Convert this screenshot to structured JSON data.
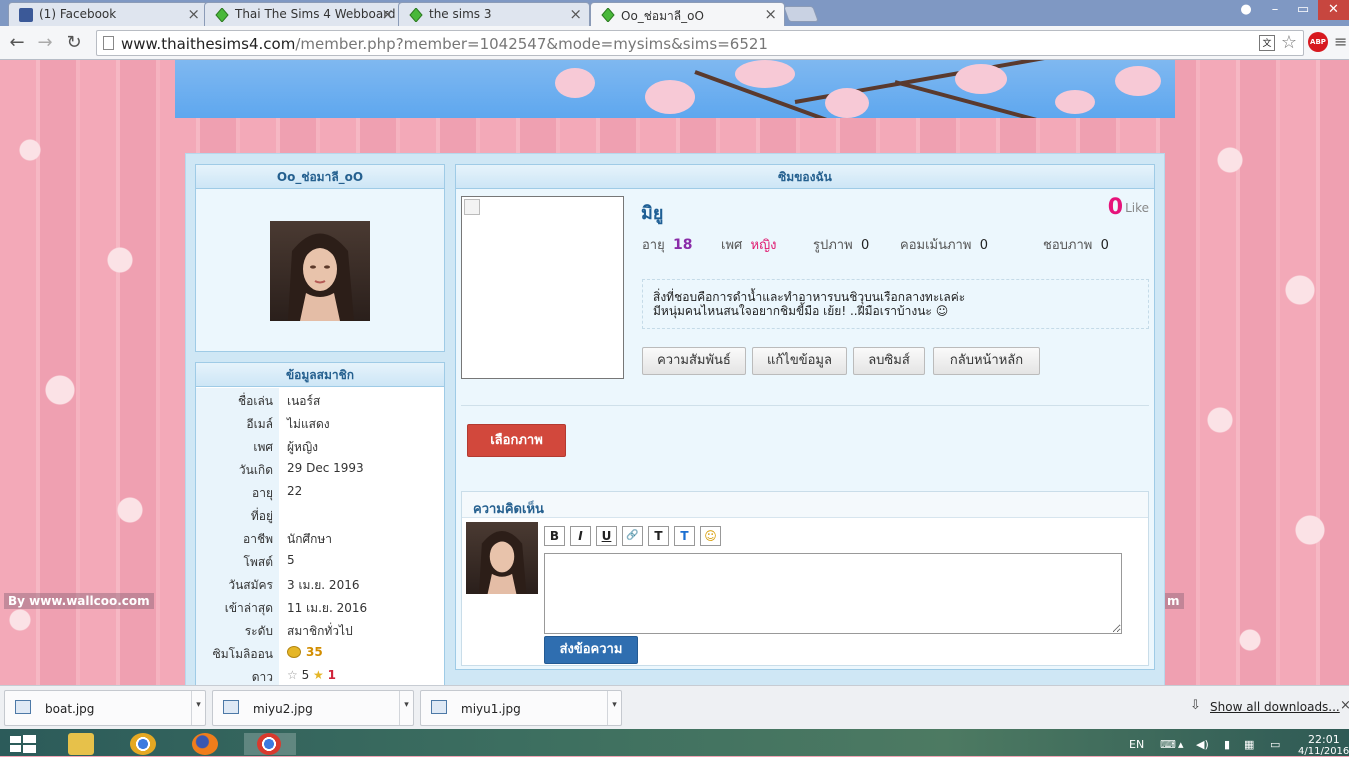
{
  "browser": {
    "tabs": [
      {
        "title": "(1) Facebook",
        "icon": "facebook-icon"
      },
      {
        "title": "Thai The Sims 4 Webboard",
        "icon": "sims-plumbob-icon"
      },
      {
        "title": "the sims 3",
        "icon": "sims-plumbob-icon"
      },
      {
        "title": "Oo_ช่อมาลี_oO",
        "icon": "sims-plumbob-icon"
      }
    ],
    "url_host": "www.thaithesims4.com",
    "url_path": "/member.php?member=1042547&mode=mysims&sims=6521",
    "extension": "ABP",
    "accent_color": "#7f98c3"
  },
  "page": {
    "watermark": "By www.wallcoo.com",
    "watermark_right": "m",
    "profile": {
      "heading": "Oo_ช่อมาลี_oO"
    },
    "member_info": {
      "heading": "ข้อมูลสมาชิก",
      "rows": [
        {
          "key": "ชื่อเล่น",
          "value": "เนอร์ส"
        },
        {
          "key": "อีเมล์",
          "value": "ไม่แสดง"
        },
        {
          "key": "เพศ",
          "value": "ผู้หญิง"
        },
        {
          "key": "วันเกิด",
          "value": "29 Dec 1993"
        },
        {
          "key": "อายุ",
          "value": "22"
        },
        {
          "key": "ที่อยู่",
          "value": ""
        },
        {
          "key": "อาชีพ",
          "value": "นักศึกษา"
        },
        {
          "key": "โพสต์",
          "value": "5"
        },
        {
          "key": "วันสมัคร",
          "value": "3 เม.ย. 2016"
        },
        {
          "key": "เข้าล่าสุด",
          "value": "11 เม.ย. 2016"
        },
        {
          "key": "ระดับ",
          "value": "สมาชิกทั่วไป"
        },
        {
          "key": "ซิมโมลิออน",
          "value": "35"
        },
        {
          "key": "ดาว",
          "value": "5"
        }
      ],
      "stars_extra": "1"
    },
    "sims": {
      "heading": "ซิมของฉัน",
      "name": "มิยู",
      "likes": "0",
      "likes_label": "Like",
      "stats": {
        "age_label": "อายุ",
        "age": "18",
        "gender_label": "เพศ",
        "gender": "หญิง",
        "photos_label": "รูปภาพ",
        "photos": "0",
        "comments_label": "คอมเม้นภาพ",
        "comments": "0",
        "likes_img_label": "ชอบภาพ",
        "likes_img": "0"
      },
      "bio_line1": "สิ่งที่ชอบคือการดำน้ำและทำอาหารบนชิวุบนเรือกลางทะเลค่ะ",
      "bio_line2": "มีหนุ่มคนไหนสนใจอยากชิมขี้มือ เย้ย! ..ฝีมือเราบ้างนะ ☺",
      "buttons": {
        "relations": "ความสัมพันธ์",
        "edit": "แก้ไขข้อมูล",
        "delete": "ลบซิมส์",
        "home": "กลับหน้าหลัก"
      },
      "choose_image": "เลือกภาพ",
      "comment_heading": "ความคิดเห็น",
      "toolbar": {
        "bold": "B",
        "italic": "I",
        "underline": "U",
        "link": "🔗",
        "size": "T",
        "color": "T",
        "emoji": "☺"
      },
      "comment_value": "",
      "send": "ส่งข้อความ"
    }
  },
  "downloads": {
    "items": [
      "boat.jpg",
      "miyu2.jpg",
      "miyu1.jpg"
    ],
    "show_all": "Show all downloads..."
  },
  "taskbar": {
    "lang": "EN",
    "time": "22:01",
    "date": "4/11/2016"
  }
}
